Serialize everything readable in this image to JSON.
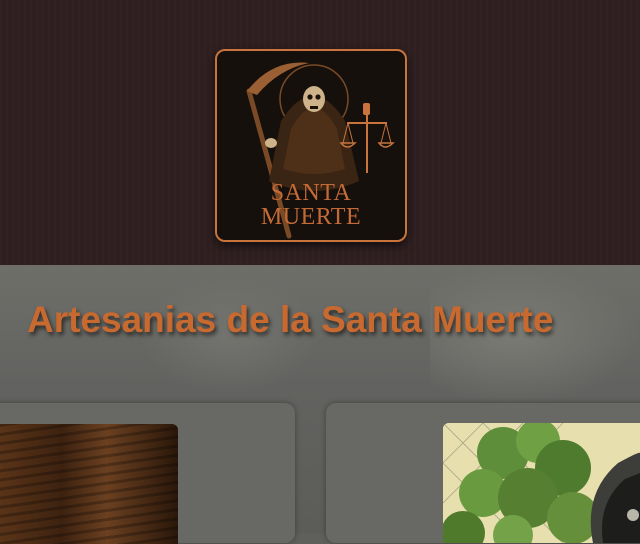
{
  "header": {
    "logo": {
      "line1": "SANTA",
      "line2": "MUERTE",
      "icon": "santa-muerte-skeleton-with-scythe-and-scales",
      "accent_color": "#c8743c"
    }
  },
  "main": {
    "title": "Artesanias de la Santa Muerte",
    "title_color": "#c86a30"
  },
  "products": [
    {
      "image": "dark-wood-carving-photo"
    },
    {
      "image": "plant-and-scythe-photo"
    }
  ]
}
